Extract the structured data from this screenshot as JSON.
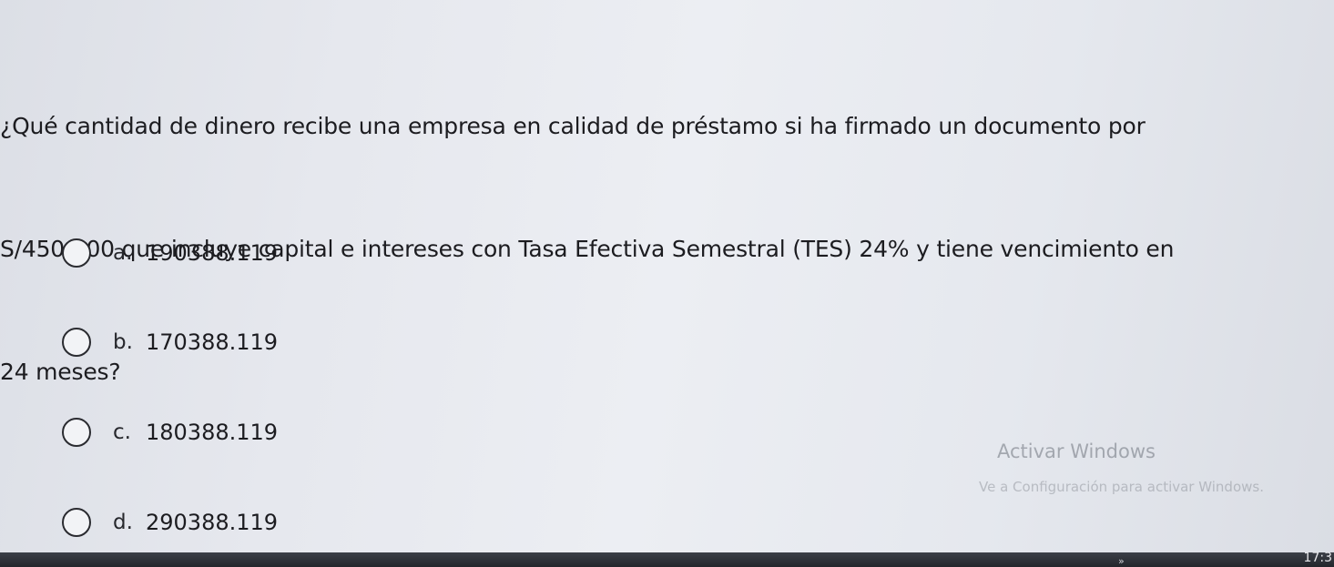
{
  "question": {
    "lines": [
      "¿Qué cantidad de dinero recibe una empresa en calidad de préstamo si ha firmado un documento por",
      "S/450,000 que incluye capital e intereses con Tasa Efectiva Semestral (TES) 24% y tiene vencimiento en",
      "24 meses?"
    ]
  },
  "options": [
    {
      "letter": "a.",
      "value": "190388.119"
    },
    {
      "letter": "b.",
      "value": "170388.119"
    },
    {
      "letter": "c.",
      "value": "180388.119"
    },
    {
      "letter": "d.",
      "value": "290388.119"
    }
  ],
  "watermark": {
    "title": "Activar Windows",
    "subtitle": "Ve a Configuración para activar Windows."
  },
  "taskbar": {
    "chevron": "»",
    "clock": "17:3"
  }
}
